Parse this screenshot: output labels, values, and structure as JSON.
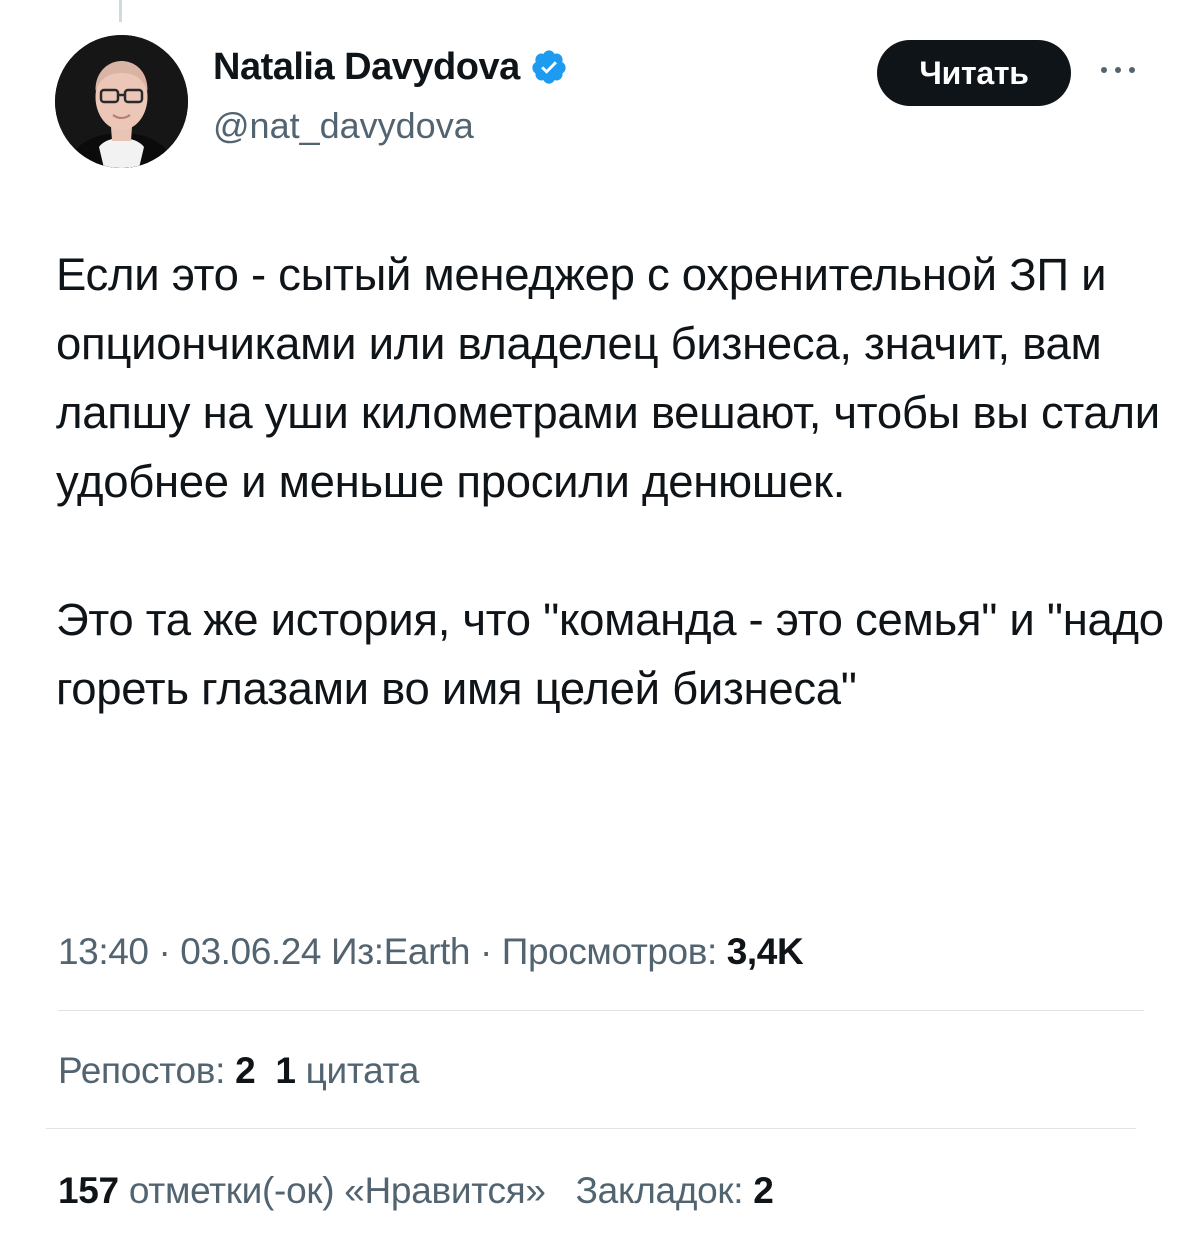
{
  "author": {
    "display_name": "Natalia Davydova",
    "handle": "@nat_davydova",
    "verified": true
  },
  "header": {
    "read_button_label": "Читать",
    "more_icon": "ellipsis-icon"
  },
  "tweet": {
    "paragraphs": [
      "Если это - сытый менеджер с охренительной ЗП и опциончиками или владелец бизнеса, значит, вам лапшу на уши километрами вешают, чтобы вы стали удобнее и меньше просили денюшек.",
      "Это та же история, что \"команда - это семья\" и \"надо гореть глазами во имя целей бизнеса\""
    ]
  },
  "meta": {
    "time": "13:40",
    "separator": " · ",
    "date": "03.06.24",
    "source_prefix": "Из:",
    "source": "Earth",
    "views_label": "Просмотров:",
    "views_value": "3,4K"
  },
  "stats": {
    "reposts_label": "Репостов:",
    "reposts_value": "2",
    "quotes_value": "1",
    "quotes_label": "цитата",
    "likes_value": "157",
    "likes_label": "отметки(-ок) «Нравится»",
    "bookmarks_label": "Закладок:",
    "bookmarks_value": "2"
  },
  "colors": {
    "text_primary": "#0f1419",
    "text_secondary": "#536471",
    "verified_blue": "#1d9bf0",
    "button_bg": "#0f1419",
    "divider": "#dfe4e8"
  }
}
